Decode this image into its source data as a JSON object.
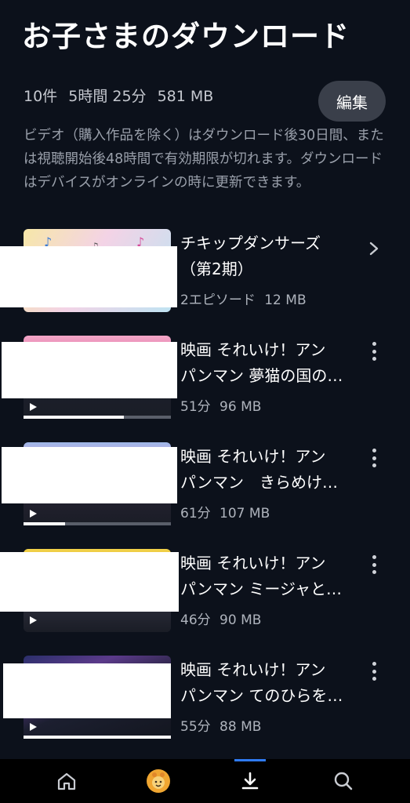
{
  "page": {
    "title": "お子さまのダウンロード",
    "stats": {
      "count": "10件",
      "duration": "5時間 25分",
      "size": "581 MB"
    },
    "edit_label": "編集",
    "notice": "ビデオ（購入作品を除く）はダウンロード後30日間、または視聴開始後48時間で有効期限が切れます。ダウンロードはデバイスがオンラインの時に更新できます。"
  },
  "items": [
    {
      "title_line1": "チキップダンサーズ",
      "title_line2": "（第2期）",
      "meta_duration": "2エピソード",
      "meta_size": "12 MB",
      "action_icon": "chevron-right-icon",
      "progress": 0
    },
    {
      "title_line1": "映画 それいけ！アン",
      "title_line2": "パンマン 夢猫の国の…",
      "meta_duration": "51分",
      "meta_size": "96 MB",
      "action_icon": "kebab-icon",
      "progress": 0.68
    },
    {
      "title_line1": "映画 それいけ！アン",
      "title_line2": "パンマン　きらめけ…",
      "meta_duration": "61分",
      "meta_size": "107 MB",
      "action_icon": "kebab-icon",
      "progress": 0.28
    },
    {
      "title_line1": "映画 それいけ！アン",
      "title_line2": "パンマン ミージャと…",
      "meta_duration": "46分",
      "meta_size": "90 MB",
      "action_icon": "kebab-icon",
      "progress": 0
    },
    {
      "title_line1": "映画 それいけ！アン",
      "title_line2": "パンマン てのひらを…",
      "meta_duration": "55分",
      "meta_size": "88 MB",
      "action_icon": "kebab-icon",
      "progress": 1.0
    }
  ],
  "bottom_nav": {
    "items": [
      "home-icon",
      "kids-profile-icon",
      "downloads-icon",
      "search-icon"
    ],
    "active": "downloads-icon",
    "accent": "#2f7bf5"
  }
}
